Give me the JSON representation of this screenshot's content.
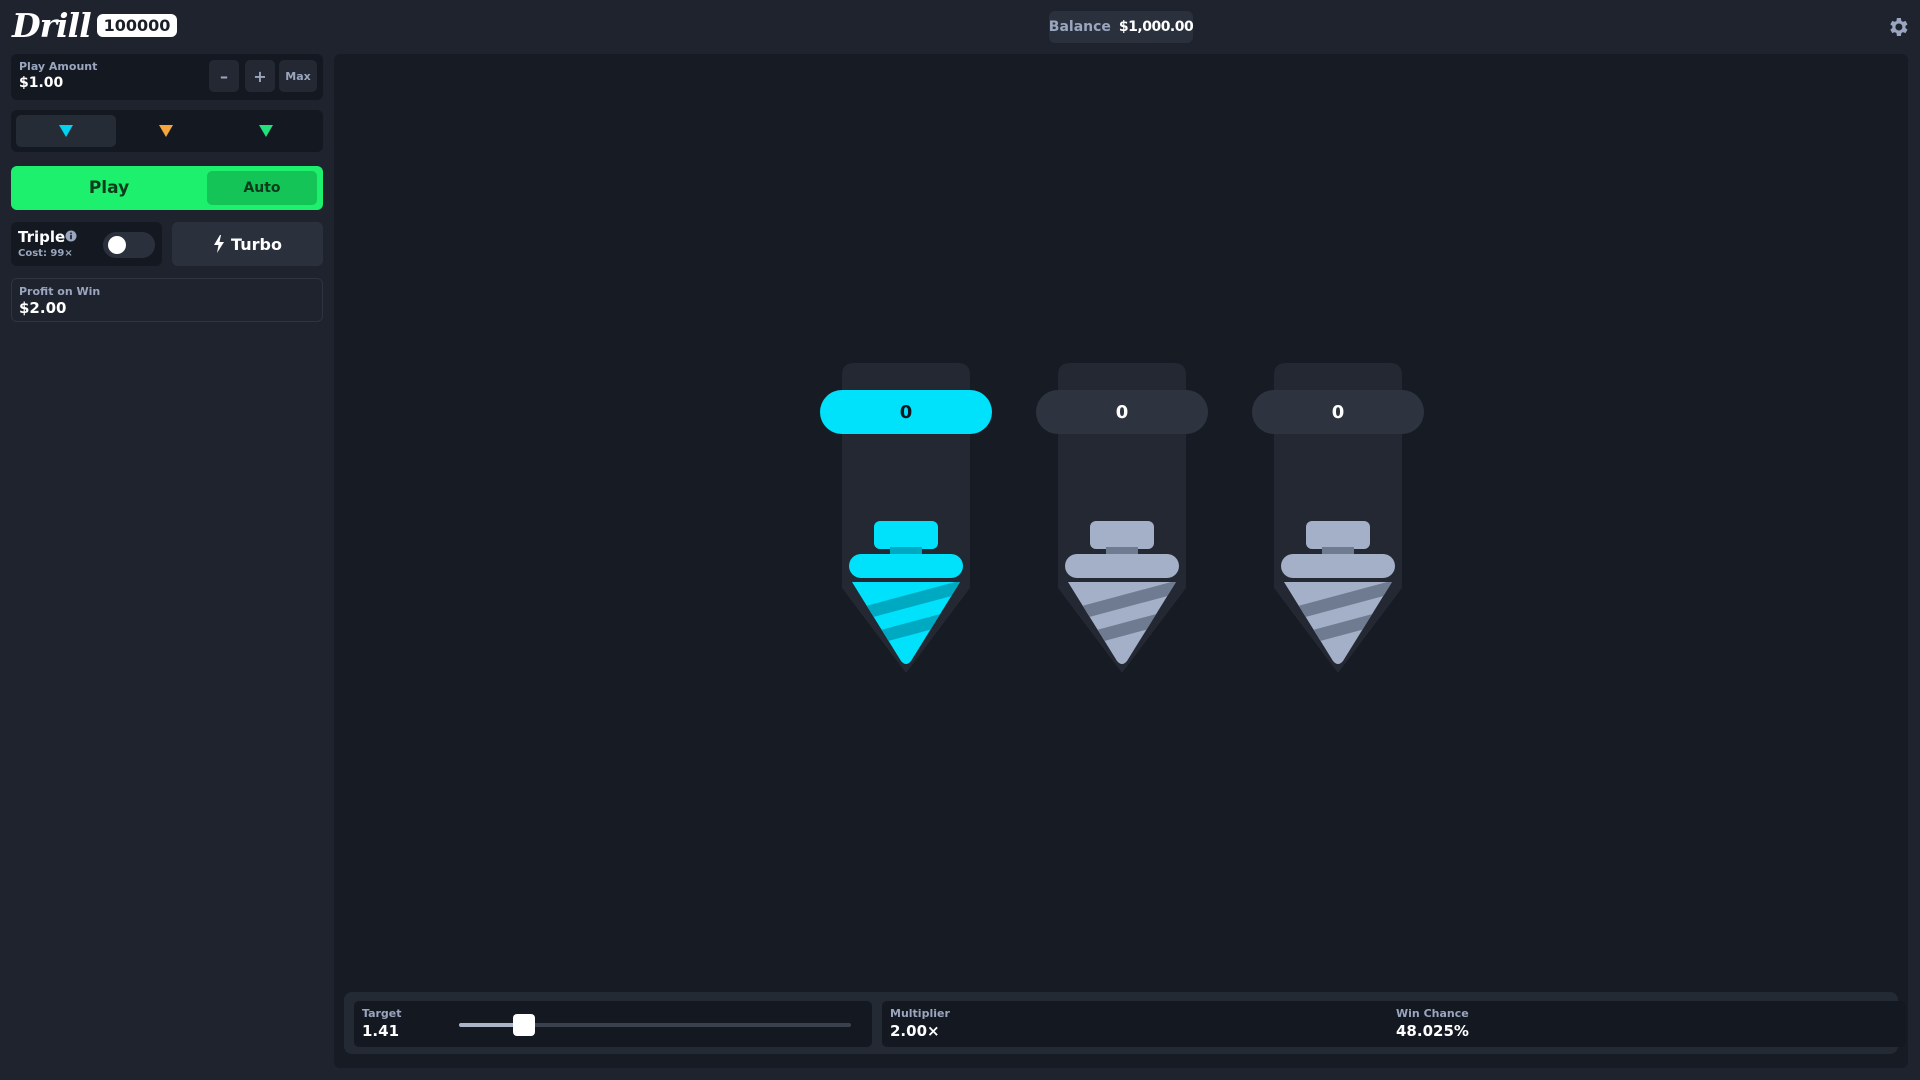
{
  "header": {
    "logo_text": "Drill",
    "logo_badge": "100000",
    "balance_label": "Balance",
    "balance_value": "$1,000.00"
  },
  "sidebar": {
    "play_amount_label": "Play Amount",
    "play_amount_value": "$1.00",
    "minus_label": "–",
    "plus_label": "+",
    "max_label": "Max",
    "mode_colors": [
      "#00d2ef",
      "#f5a53b",
      "#22e07c"
    ],
    "play_label": "Play",
    "auto_label": "Auto",
    "triple_label": "Triple",
    "triple_cost": "Cost: 99×",
    "triple_enabled": false,
    "turbo_label": "Turbo",
    "profit_label": "Profit on Win",
    "profit_value": "$2.00"
  },
  "drills": [
    {
      "value": "0",
      "active": true
    },
    {
      "value": "0",
      "active": false
    },
    {
      "value": "0",
      "active": false
    }
  ],
  "bottom": {
    "target_label": "Target",
    "target_value": "1.41",
    "slider_fraction": 0.165,
    "multiplier_label": "Multiplier",
    "multiplier_value": "2.00×",
    "win_chance_label": "Win Chance",
    "win_chance_value": "48.025%"
  },
  "colors": {
    "accent_green": "#1cf06d",
    "drill_active": "#00e1fb",
    "drill_inactive": "#a3b0c8"
  }
}
